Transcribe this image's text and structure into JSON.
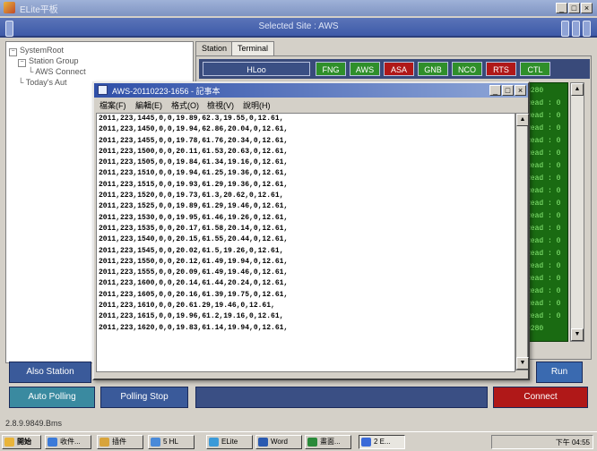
{
  "app": {
    "title": "ELite平板"
  },
  "header": {
    "site_label": "Selected Site : AWS"
  },
  "tree": {
    "root": "SystemRoot",
    "group": "Station Group",
    "item": "AWS Connect",
    "leaf": "Today's Aut"
  },
  "tabs": [
    "Station",
    "Terminal"
  ],
  "panel_buttons": [
    "HLoo",
    "FNG",
    "AWS",
    "ASA",
    "GNB",
    "NCO",
    "RTS",
    "CTL"
  ],
  "colors": {
    "green_button": "#2f8f2a",
    "red_button": "#b01818",
    "header_blue": "#3e5aa8"
  },
  "log": {
    "lines": [
      "0280",
      "Read : 0",
      "Read : 0",
      "Read : 0",
      "Read : 0",
      "Read : 0",
      "Read : 0",
      "Read : 0",
      "Read : 0",
      "Read : 0",
      "Read : 0",
      "Read : 0",
      "Read : 0",
      "Read : 0",
      "Read : 0",
      "Read : 0",
      "Read : 0",
      "Read : 0",
      "Read : 0",
      "0280"
    ]
  },
  "notepad": {
    "title": "AWS-20110223-1656 - 記事本",
    "menu": [
      "檔案(F)",
      "編輯(E)",
      "格式(O)",
      "檢視(V)",
      "說明(H)"
    ],
    "lines": [
      "2011,223,1445,0,0,19.89,62.3,19.55,0,12.61,",
      "2011,223,1450,0,0,19.94,62.86,20.04,0,12.61,",
      "2011,223,1455,0,0,19.78,61.76,20.34,0,12.61,",
      "2011,223,1500,0,0,20.11,61.53,20.63,0,12.61,",
      "2011,223,1505,0,0,19.84,61.34,19.16,0,12.61,",
      "2011,223,1510,0,0,19.94,61.25,19.36,0,12.61,",
      "2011,223,1515,0,0,19.93,61.29,19.36,0,12.61,",
      "2011,223,1520,0,0,19.73,61.3,20.62,0,12.61,",
      "2011,223,1525,0,0,19.89,61.29,19.46,0,12.61,",
      "2011,223,1530,0,0,19.95,61.46,19.26,0,12.61,",
      "2011,223,1535,0,0,20.17,61.58,20.14,0,12.61,",
      "2011,223,1540,0,0,20.15,61.55,20.44,0,12.61,",
      "2011,223,1545,0,0,20.02,61.5,19.26,0,12.61,",
      "2011,223,1550,0,0,20.12,61.49,19.94,0,12.61,",
      "2011,223,1555,0,0,20.09,61.49,19.46,0,12.61,",
      "2011,223,1600,0,0,20.14,61.44,20.24,0,12.61,",
      "2011,223,1605,0,0,20.16,61.39,19.75,0,12.61,",
      "2011,223,1610,0,0,20.61.29,19.46,0,12.61,",
      "2011,223,1615,0,0,19.96,61.2,19.16,0,12.61,",
      "2011,223,1620,0,0,19.83,61.14,19.94,0,12.61,"
    ]
  },
  "controls": {
    "left_top": "Also Station",
    "left_bottom_1": "Auto Polling",
    "left_bottom_2": "Polling Stop",
    "run": "Run",
    "connect": "Connect"
  },
  "coords": "2.8.9.9849.Bms",
  "taskbar": {
    "start": "開始",
    "items": [
      "收件...",
      "插件",
      "5 HL",
      "ELite",
      "Word",
      "畫面...",
      "2 E..."
    ],
    "active_index": 6,
    "clock": "下午 04:55"
  }
}
